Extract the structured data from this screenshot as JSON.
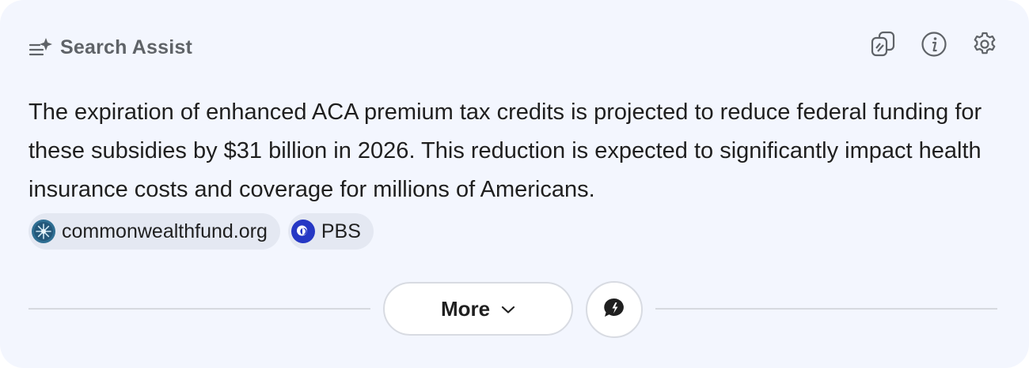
{
  "header": {
    "title": "Search Assist",
    "title_icon": "sparkle-list-icon"
  },
  "toolbar": {
    "icons": [
      "copy-icon",
      "info-icon",
      "settings-gear-icon"
    ]
  },
  "answer": {
    "text": "The expiration of enhanced ACA premium tax credits is projected to reduce federal funding for these subsidies by $31 billion in 2026. This reduction is expected to significantly impact health insurance costs and coverage for millions of Americans."
  },
  "sources": [
    {
      "label": "commonwealthfund.org",
      "icon": "commonwealthfund-favicon"
    },
    {
      "label": "PBS",
      "icon": "pbs-logo-icon"
    }
  ],
  "actions": {
    "more_label": "More",
    "chat_icon": "chat-bubble-icon"
  },
  "colors": {
    "card_background": "#f3f6fe",
    "header_text": "#5f6368",
    "body_text": "#1f1f1f",
    "chip_background": "#e4e8f2",
    "pbs_blue": "#2638c4",
    "divider": "#d6d9df"
  }
}
